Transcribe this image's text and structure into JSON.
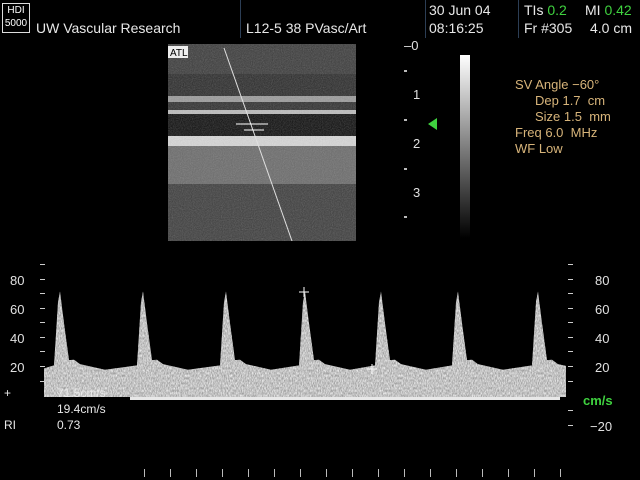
{
  "header": {
    "logo_top": "HDI",
    "logo_bottom": "5000",
    "institution": "UW Vascular Research",
    "transducer": "L12-5 38 PVasc/Art",
    "date": "30 Jun 04",
    "time": "08:16:25",
    "ti_label": "TIs",
    "ti_value": "0.2",
    "mi_label": "MI",
    "mi_value": "0.42",
    "frame": "Fr #305",
    "depth_cm": "4.0 cm"
  },
  "image_panel": {
    "brand_tag": "ATL",
    "depth_ticks": [
      "0",
      "1",
      "2",
      "3"
    ]
  },
  "doppler_settings": {
    "sv_angle": "SV Angle −60°",
    "depth": "Dep 1.7  cm",
    "size": "Size 1.5  mm",
    "freq": "Freq 6.0  MHz",
    "wall_filter": "WF Low"
  },
  "spectral": {
    "left_axis": [
      "80",
      "60",
      "40",
      "20"
    ],
    "right_axis": [
      "80",
      "60",
      "40",
      "20"
    ],
    "units": "cm/s",
    "neg_label": "−20",
    "baseline_cm_s": 0,
    "peak_systolic_cm_s": 71.5,
    "end_diastolic_cm_s": 19.4
  },
  "measurements": {
    "psv": "71.5cm/s",
    "edv": "19.4cm/s",
    "ri_label": "RI",
    "ri_value": "0.73"
  }
}
